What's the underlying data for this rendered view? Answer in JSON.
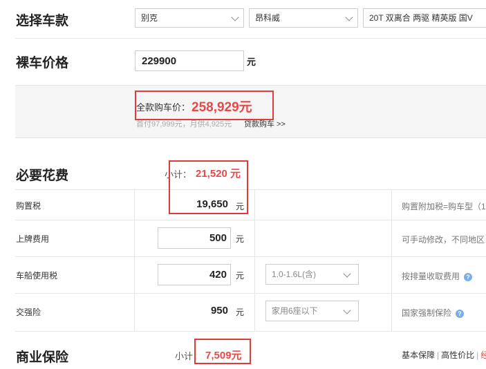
{
  "select_model": {
    "title": "选择车款",
    "brand": "别克",
    "series": "昂科威",
    "model": "20T 双离合 两驱 精英版 国V"
  },
  "bare_price": {
    "title": "裸车价格",
    "value": "229900",
    "unit": "元"
  },
  "full_price": {
    "label": "全款购车价：",
    "value": "258,929元",
    "sub_text": "首付97,999元，月供4,925元",
    "loan_link": "贷款购车 >>"
  },
  "required": {
    "title": "必要花费",
    "subtotal_label": "小计：",
    "subtotal_value": "21,520 元",
    "rows": [
      {
        "label": "购置税",
        "value": "19,650",
        "unit": "元",
        "note": "购置附加税=购车型（1"
      },
      {
        "label": "上牌费用",
        "value": "500",
        "unit": "元",
        "note": "可手动修改，不同地区"
      },
      {
        "label": "车船使用税",
        "value": "420",
        "unit": "元",
        "select": "1.0-1.6L(含)",
        "note": "按排量收取费用"
      },
      {
        "label": "交强险",
        "value": "950",
        "unit": "元",
        "select": "家用6座以下",
        "note": "国家强制保险"
      }
    ]
  },
  "commercial": {
    "title": "商业保险",
    "subtotal_label": "小计：",
    "subtotal_value": "7,509元",
    "tabs": [
      "基本保障",
      "高性价比",
      "经"
    ]
  },
  "colors": {
    "accent_red": "#e94848",
    "highlight_box": "#e03a3a",
    "help_icon": "#7aaee8"
  }
}
